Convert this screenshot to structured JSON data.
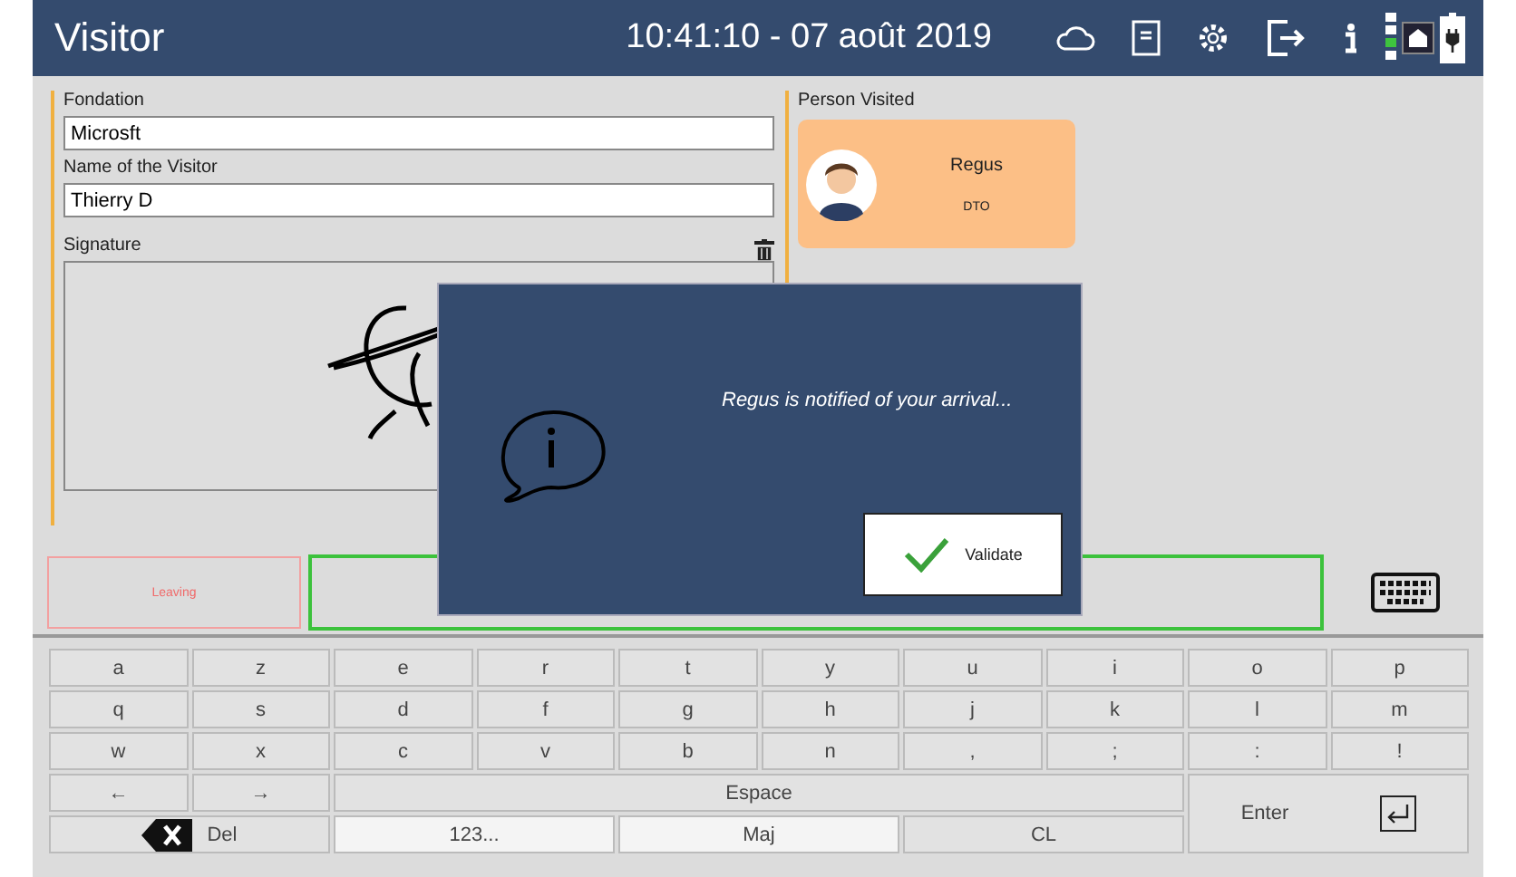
{
  "header": {
    "title": "Visitor",
    "datetime": "10:41:10 - 07 août 2019"
  },
  "fields": [
    {
      "label": "Fondation",
      "value": "Microsft"
    },
    {
      "label": "Name of the Visitor",
      "value": "Thierry D"
    }
  ],
  "signature": {
    "label": "Signature"
  },
  "person_visited": {
    "label": "Person Visited",
    "name": "Regus",
    "role": "DTO"
  },
  "leaving_button": "Leaving",
  "dialog": {
    "message": "Regus is notified of your arrival...",
    "button": "Validate"
  },
  "keyboard": [
    {
      "label": "a",
      "kind": "char"
    },
    {
      "label": "z",
      "kind": "char"
    },
    {
      "label": "e",
      "kind": "char"
    },
    {
      "label": "r",
      "kind": "char"
    },
    {
      "label": "t",
      "kind": "char"
    },
    {
      "label": "y",
      "kind": "char"
    },
    {
      "label": "u",
      "kind": "char"
    },
    {
      "label": "i",
      "kind": "char"
    },
    {
      "label": "o",
      "kind": "char"
    },
    {
      "label": "p",
      "kind": "char"
    },
    {
      "label": "q",
      "kind": "char"
    },
    {
      "label": "s",
      "kind": "char"
    },
    {
      "label": "d",
      "kind": "char"
    },
    {
      "label": "f",
      "kind": "char"
    },
    {
      "label": "g",
      "kind": "char"
    },
    {
      "label": "h",
      "kind": "char"
    },
    {
      "label": "j",
      "kind": "char"
    },
    {
      "label": "k",
      "kind": "char"
    },
    {
      "label": "l",
      "kind": "char"
    },
    {
      "label": "m",
      "kind": "char"
    },
    {
      "label": "w",
      "kind": "char"
    },
    {
      "label": "x",
      "kind": "char"
    },
    {
      "label": "c",
      "kind": "char"
    },
    {
      "label": "v",
      "kind": "char"
    },
    {
      "label": "b",
      "kind": "char"
    },
    {
      "label": "n",
      "kind": "char"
    },
    {
      "label": ",",
      "kind": "char"
    },
    {
      "label": ";",
      "kind": "char"
    },
    {
      "label": ":",
      "kind": "char"
    },
    {
      "label": "!",
      "kind": "char"
    },
    {
      "label": "←",
      "kind": "char"
    },
    {
      "label": "→",
      "kind": "char"
    },
    {
      "label": "Espace",
      "kind": "space"
    },
    {
      "label": "Enter",
      "kind": "enter"
    },
    {
      "label": "Del",
      "kind": "delete"
    },
    {
      "label": "123...",
      "kind": "mode"
    },
    {
      "label": "Maj",
      "kind": "mode"
    },
    {
      "label": "CL",
      "kind": "wide"
    }
  ]
}
